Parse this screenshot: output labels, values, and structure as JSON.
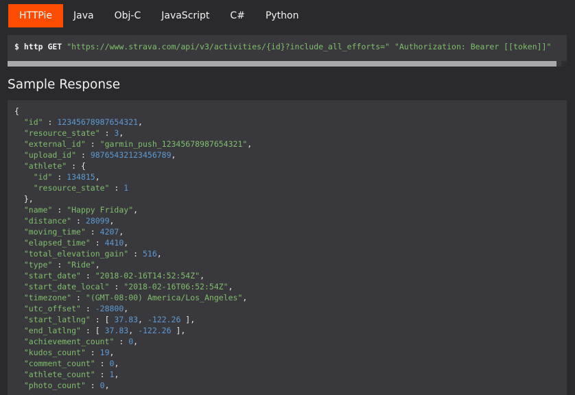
{
  "tabs": [
    {
      "label": "HTTPie",
      "active": true
    },
    {
      "label": "Java",
      "active": false
    },
    {
      "label": "Obj-C",
      "active": false
    },
    {
      "label": "JavaScript",
      "active": false
    },
    {
      "label": "C#",
      "active": false
    },
    {
      "label": "Python",
      "active": false
    }
  ],
  "request": {
    "prompt": "$ http GET",
    "url": "\"https://www.strava.com/api/v3/activities/{id}?include_all_efforts=\"",
    "header": "\"Authorization: Bearer [[token]]\""
  },
  "section_title": "Sample Response",
  "colors": {
    "accent": "#fc4c02",
    "key": "#7fbf6a",
    "number": "#5b9bd5"
  },
  "response_lines": [
    [
      [
        "p",
        "{"
      ]
    ],
    [
      [
        "p",
        "  "
      ],
      [
        "k",
        "\"id\""
      ],
      [
        "p",
        " : "
      ],
      [
        "n",
        "12345678987654321"
      ],
      [
        "p",
        ","
      ]
    ],
    [
      [
        "p",
        "  "
      ],
      [
        "k",
        "\"resource_state\""
      ],
      [
        "p",
        " : "
      ],
      [
        "n",
        "3"
      ],
      [
        "p",
        ","
      ]
    ],
    [
      [
        "p",
        "  "
      ],
      [
        "k",
        "\"external_id\""
      ],
      [
        "p",
        " : "
      ],
      [
        "s",
        "\"garmin_push_12345678987654321\""
      ],
      [
        "p",
        ","
      ]
    ],
    [
      [
        "p",
        "  "
      ],
      [
        "k",
        "\"upload_id\""
      ],
      [
        "p",
        " : "
      ],
      [
        "n",
        "98765432123456789"
      ],
      [
        "p",
        ","
      ]
    ],
    [
      [
        "p",
        "  "
      ],
      [
        "k",
        "\"athlete\""
      ],
      [
        "p",
        " : {"
      ]
    ],
    [
      [
        "p",
        "    "
      ],
      [
        "k",
        "\"id\""
      ],
      [
        "p",
        " : "
      ],
      [
        "n",
        "134815"
      ],
      [
        "p",
        ","
      ]
    ],
    [
      [
        "p",
        "    "
      ],
      [
        "k",
        "\"resource_state\""
      ],
      [
        "p",
        " : "
      ],
      [
        "n",
        "1"
      ]
    ],
    [
      [
        "p",
        "  },"
      ]
    ],
    [
      [
        "p",
        "  "
      ],
      [
        "k",
        "\"name\""
      ],
      [
        "p",
        " : "
      ],
      [
        "s",
        "\"Happy Friday\""
      ],
      [
        "p",
        ","
      ]
    ],
    [
      [
        "p",
        "  "
      ],
      [
        "k",
        "\"distance\""
      ],
      [
        "p",
        " : "
      ],
      [
        "n",
        "28099"
      ],
      [
        "p",
        ","
      ]
    ],
    [
      [
        "p",
        "  "
      ],
      [
        "k",
        "\"moving_time\""
      ],
      [
        "p",
        " : "
      ],
      [
        "n",
        "4207"
      ],
      [
        "p",
        ","
      ]
    ],
    [
      [
        "p",
        "  "
      ],
      [
        "k",
        "\"elapsed_time\""
      ],
      [
        "p",
        " : "
      ],
      [
        "n",
        "4410"
      ],
      [
        "p",
        ","
      ]
    ],
    [
      [
        "p",
        "  "
      ],
      [
        "k",
        "\"total_elevation_gain\""
      ],
      [
        "p",
        " : "
      ],
      [
        "n",
        "516"
      ],
      [
        "p",
        ","
      ]
    ],
    [
      [
        "p",
        "  "
      ],
      [
        "k",
        "\"type\""
      ],
      [
        "p",
        " : "
      ],
      [
        "s",
        "\"Ride\""
      ],
      [
        "p",
        ","
      ]
    ],
    [
      [
        "p",
        "  "
      ],
      [
        "k",
        "\"start_date\""
      ],
      [
        "p",
        " : "
      ],
      [
        "s",
        "\"2018-02-16T14:52:54Z\""
      ],
      [
        "p",
        ","
      ]
    ],
    [
      [
        "p",
        "  "
      ],
      [
        "k",
        "\"start_date_local\""
      ],
      [
        "p",
        " : "
      ],
      [
        "s",
        "\"2018-02-16T06:52:54Z\""
      ],
      [
        "p",
        ","
      ]
    ],
    [
      [
        "p",
        "  "
      ],
      [
        "k",
        "\"timezone\""
      ],
      [
        "p",
        " : "
      ],
      [
        "s",
        "\"(GMT-08:00) America/Los_Angeles\""
      ],
      [
        "p",
        ","
      ]
    ],
    [
      [
        "p",
        "  "
      ],
      [
        "k",
        "\"utc_offset\""
      ],
      [
        "p",
        " : "
      ],
      [
        "n",
        "-28800"
      ],
      [
        "p",
        ","
      ]
    ],
    [
      [
        "p",
        "  "
      ],
      [
        "k",
        "\"start_latlng\""
      ],
      [
        "p",
        " : [ "
      ],
      [
        "n",
        "37.83"
      ],
      [
        "p",
        ", "
      ],
      [
        "n",
        "-122.26"
      ],
      [
        "p",
        " ],"
      ]
    ],
    [
      [
        "p",
        "  "
      ],
      [
        "k",
        "\"end_latlng\""
      ],
      [
        "p",
        " : [ "
      ],
      [
        "n",
        "37.83"
      ],
      [
        "p",
        ", "
      ],
      [
        "n",
        "-122.26"
      ],
      [
        "p",
        " ],"
      ]
    ],
    [
      [
        "p",
        "  "
      ],
      [
        "k",
        "\"achievement_count\""
      ],
      [
        "p",
        " : "
      ],
      [
        "n",
        "0"
      ],
      [
        "p",
        ","
      ]
    ],
    [
      [
        "p",
        "  "
      ],
      [
        "k",
        "\"kudos_count\""
      ],
      [
        "p",
        " : "
      ],
      [
        "n",
        "19"
      ],
      [
        "p",
        ","
      ]
    ],
    [
      [
        "p",
        "  "
      ],
      [
        "k",
        "\"comment_count\""
      ],
      [
        "p",
        " : "
      ],
      [
        "n",
        "0"
      ],
      [
        "p",
        ","
      ]
    ],
    [
      [
        "p",
        "  "
      ],
      [
        "k",
        "\"athlete_count\""
      ],
      [
        "p",
        " : "
      ],
      [
        "n",
        "1"
      ],
      [
        "p",
        ","
      ]
    ],
    [
      [
        "p",
        "  "
      ],
      [
        "k",
        "\"photo_count\""
      ],
      [
        "p",
        " : "
      ],
      [
        "n",
        "0"
      ],
      [
        "p",
        ","
      ]
    ]
  ]
}
